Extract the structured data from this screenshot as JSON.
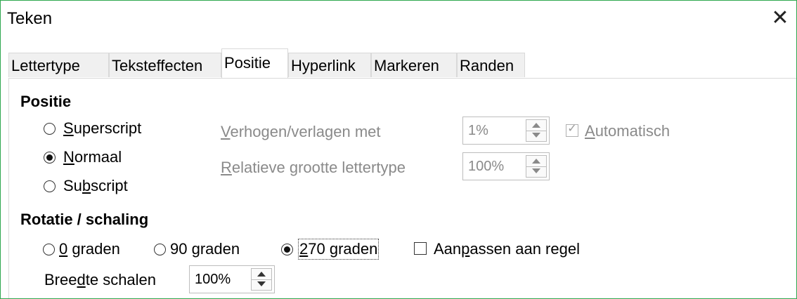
{
  "window": {
    "title": "Teken",
    "close_glyph": "✕"
  },
  "tabs": [
    "Lettertype",
    "Teksteffecten",
    "Positie",
    "Hyperlink",
    "Markeren",
    "Randen"
  ],
  "active_tab": "Positie",
  "position": {
    "heading": "Positie",
    "options": {
      "superscript": {
        "pre": "",
        "key": "S",
        "post": "uperscript"
      },
      "normal": {
        "pre": "",
        "key": "N",
        "post": "ormaal"
      },
      "subscript": {
        "pre": "Su",
        "key": "b",
        "post": "script"
      }
    },
    "selected": "Normaal",
    "raise_lower": {
      "pre": "",
      "key": "V",
      "post": "erhogen/verlagen met",
      "value": "1%"
    },
    "relative_size": {
      "pre": "",
      "key": "R",
      "post": "elatieve grootte lettertype",
      "value": "100%"
    },
    "automatic": {
      "pre": "",
      "key": "A",
      "post": "utomatisch",
      "checked": true
    }
  },
  "rotation": {
    "heading": "Rotatie / schaling",
    "deg0": {
      "pre": "",
      "key": "0",
      "post": " graden"
    },
    "deg90": {
      "pre": "90 ",
      "key": "g",
      "post": "raden"
    },
    "deg270": {
      "pre": "",
      "key": "2",
      "post": "70 graden"
    },
    "selected": "270 graden",
    "fit_to_line": {
      "pre": "Aan",
      "key": "p",
      "post": "assen aan regel",
      "checked": false
    },
    "scale_width": {
      "pre": "Bree",
      "key": "d",
      "post": "te schalen",
      "value": "100%"
    }
  },
  "icons": {
    "close": "close-icon",
    "spin_up": "arrow-up-icon",
    "spin_down": "arrow-down-icon",
    "check": "checkmark-icon"
  },
  "colors": {
    "window_border": "#2fa84f",
    "disabled_text": "#8a8a8a",
    "tab_inactive": "#f0f0f0"
  }
}
